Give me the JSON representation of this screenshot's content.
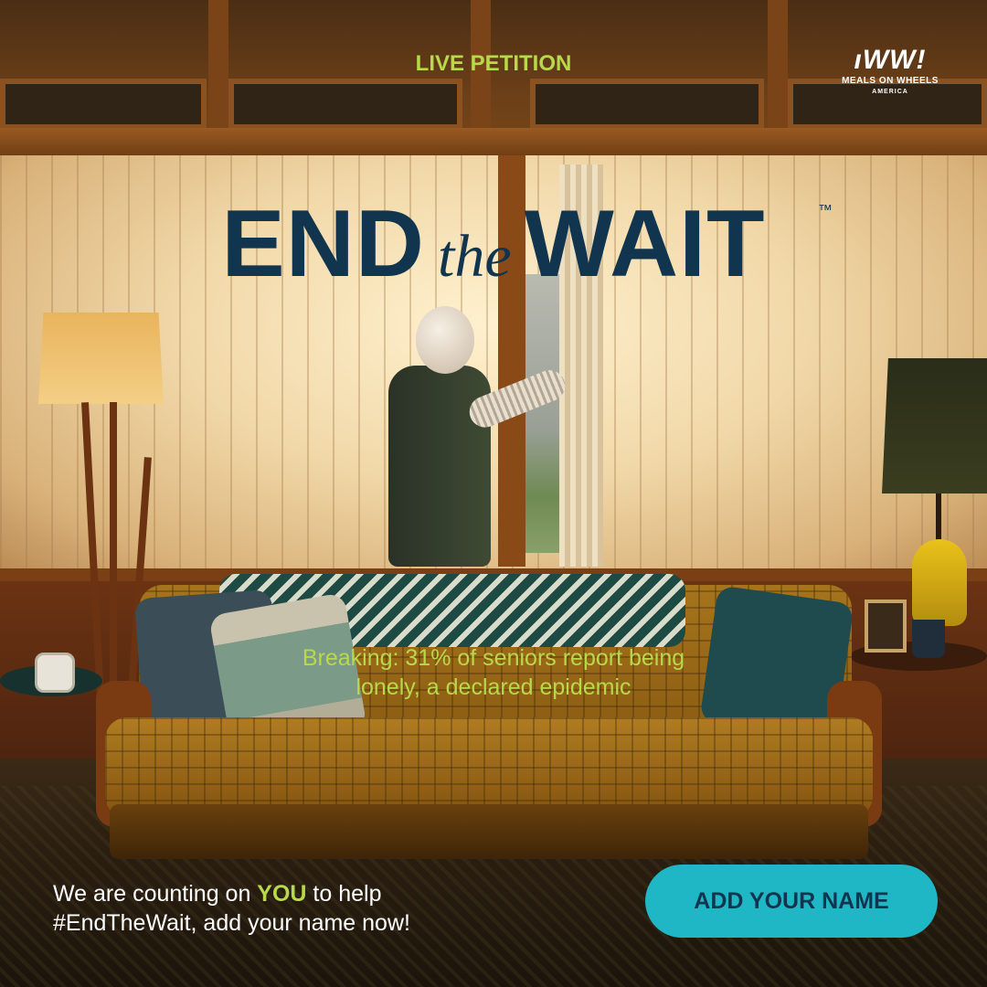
{
  "header": {
    "tag": "LIVE PETITION"
  },
  "logo": {
    "mark": "ıWW!",
    "line": "MEALS ON WHEELS",
    "sub": "AMERICA"
  },
  "title": {
    "part1": "END",
    "part2": "the",
    "part3": "WAIT",
    "trademark": "™"
  },
  "stat": {
    "line1": "Breaking: 31% of seniors report being",
    "line2": "lonely, a declared epidemic"
  },
  "cta": {
    "pre": "We are counting on ",
    "emphasis": "YOU",
    "post": " to help",
    "line2": "#EndTheWait, add your name now!",
    "button_label": "ADD YOUR NAME"
  },
  "colors": {
    "accent_green": "#b8d94a",
    "navy": "#12354f",
    "button_teal": "#1fb7c5"
  }
}
